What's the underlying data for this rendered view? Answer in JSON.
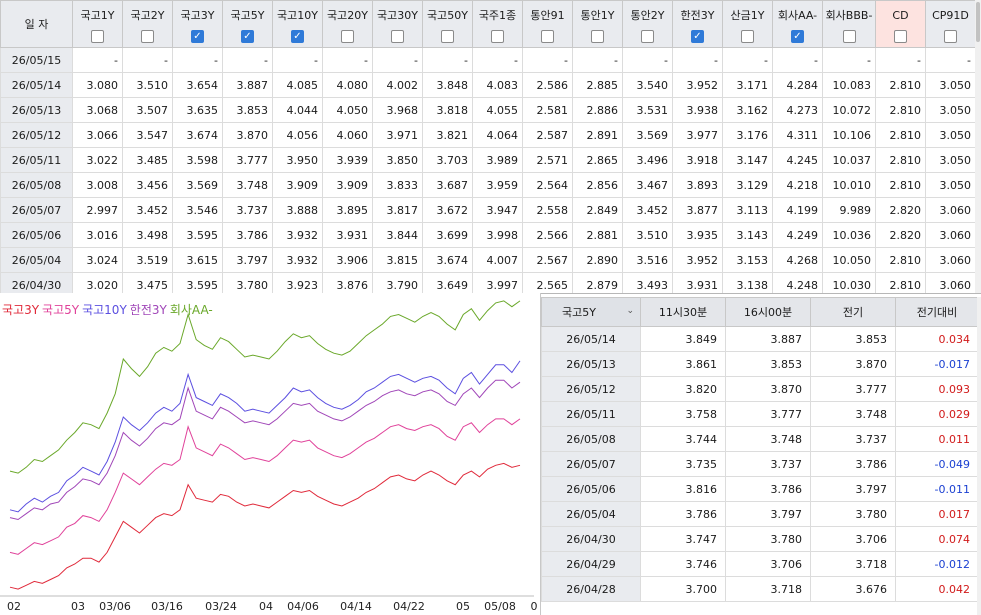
{
  "top_table": {
    "date_header": "일  자",
    "columns": [
      {
        "label": "국고1Y",
        "checked": false
      },
      {
        "label": "국고2Y",
        "checked": false
      },
      {
        "label": "국고3Y",
        "checked": true
      },
      {
        "label": "국고5Y",
        "checked": true
      },
      {
        "label": "국고10Y",
        "checked": true
      },
      {
        "label": "국고20Y",
        "checked": false
      },
      {
        "label": "국고30Y",
        "checked": false
      },
      {
        "label": "국고50Y",
        "checked": false
      },
      {
        "label": "국주1종",
        "checked": false
      },
      {
        "label": "통안91",
        "checked": false
      },
      {
        "label": "통안1Y",
        "checked": false
      },
      {
        "label": "통안2Y",
        "checked": false
      },
      {
        "label": "한전3Y",
        "checked": true
      },
      {
        "label": "산금1Y",
        "checked": false
      },
      {
        "label": "회사AA-",
        "checked": true
      },
      {
        "label": "회사BBB-",
        "checked": false
      },
      {
        "label": "CD",
        "checked": false
      },
      {
        "label": "CP91D",
        "checked": false
      }
    ],
    "rows": [
      {
        "date": "26/05/15",
        "values": [
          "-",
          "-",
          "-",
          "-",
          "-",
          "-",
          "-",
          "-",
          "-",
          "-",
          "-",
          "-",
          "-",
          "-",
          "-",
          "-",
          "-",
          "-"
        ]
      },
      {
        "date": "26/05/14",
        "values": [
          "3.080",
          "3.510",
          "3.654",
          "3.887",
          "4.085",
          "4.080",
          "4.002",
          "3.848",
          "4.083",
          "2.586",
          "2.885",
          "3.540",
          "3.952",
          "3.171",
          "4.284",
          "10.083",
          "2.810",
          "3.050"
        ]
      },
      {
        "date": "26/05/13",
        "values": [
          "3.068",
          "3.507",
          "3.635",
          "3.853",
          "4.044",
          "4.050",
          "3.968",
          "3.818",
          "4.055",
          "2.581",
          "2.886",
          "3.531",
          "3.938",
          "3.162",
          "4.273",
          "10.072",
          "2.810",
          "3.050"
        ]
      },
      {
        "date": "26/05/12",
        "values": [
          "3.066",
          "3.547",
          "3.674",
          "3.870",
          "4.056",
          "4.060",
          "3.971",
          "3.821",
          "4.064",
          "2.587",
          "2.891",
          "3.569",
          "3.977",
          "3.176",
          "4.311",
          "10.106",
          "2.810",
          "3.050"
        ]
      },
      {
        "date": "26/05/11",
        "values": [
          "3.022",
          "3.485",
          "3.598",
          "3.777",
          "3.950",
          "3.939",
          "3.850",
          "3.703",
          "3.989",
          "2.571",
          "2.865",
          "3.496",
          "3.918",
          "3.147",
          "4.245",
          "10.037",
          "2.810",
          "3.050"
        ]
      },
      {
        "date": "26/05/08",
        "values": [
          "3.008",
          "3.456",
          "3.569",
          "3.748",
          "3.909",
          "3.909",
          "3.833",
          "3.687",
          "3.959",
          "2.564",
          "2.856",
          "3.467",
          "3.893",
          "3.129",
          "4.218",
          "10.010",
          "2.810",
          "3.050"
        ]
      },
      {
        "date": "26/05/07",
        "values": [
          "2.997",
          "3.452",
          "3.546",
          "3.737",
          "3.888",
          "3.895",
          "3.817",
          "3.672",
          "3.947",
          "2.558",
          "2.849",
          "3.452",
          "3.877",
          "3.113",
          "4.199",
          "9.989",
          "2.820",
          "3.060"
        ]
      },
      {
        "date": "26/05/06",
        "values": [
          "3.016",
          "3.498",
          "3.595",
          "3.786",
          "3.932",
          "3.931",
          "3.844",
          "3.699",
          "3.998",
          "2.566",
          "2.881",
          "3.510",
          "3.935",
          "3.143",
          "4.249",
          "10.036",
          "2.820",
          "3.060"
        ]
      },
      {
        "date": "26/05/04",
        "values": [
          "3.024",
          "3.519",
          "3.615",
          "3.797",
          "3.932",
          "3.906",
          "3.815",
          "3.674",
          "4.007",
          "2.567",
          "2.890",
          "3.516",
          "3.952",
          "3.153",
          "4.268",
          "10.050",
          "2.810",
          "3.060"
        ]
      },
      {
        "date": "26/04/30",
        "values": [
          "3.020",
          "3.475",
          "3.595",
          "3.780",
          "3.923",
          "3.876",
          "3.790",
          "3.649",
          "3.997",
          "2.565",
          "2.879",
          "3.493",
          "3.931",
          "3.138",
          "4.248",
          "10.030",
          "2.810",
          "3.060"
        ]
      }
    ]
  },
  "chart_data": {
    "type": "line",
    "legend": [
      "국고3Y",
      "국고5Y",
      "국고10Y",
      "한전3Y",
      "회사AA-"
    ],
    "colors": [
      "#e0293a",
      "#e0429a",
      "#5b4fe0",
      "#a046b8",
      "#6aa82a"
    ],
    "x_tick_labels": [
      "02",
      "03",
      "03/06",
      "03/16",
      "03/24",
      "04",
      "04/06",
      "04/14",
      "04/22",
      "05",
      "05/08",
      "0"
    ],
    "series": [
      {
        "name": "국고3Y",
        "color": "#e0293a",
        "values": [
          3.02,
          3.01,
          3.03,
          3.05,
          3.04,
          3.06,
          3.08,
          3.12,
          3.14,
          3.17,
          3.17,
          3.15,
          3.2,
          3.28,
          3.36,
          3.33,
          3.3,
          3.34,
          3.38,
          3.4,
          3.39,
          3.42,
          3.55,
          3.48,
          3.47,
          3.46,
          3.5,
          3.49,
          3.46,
          3.44,
          3.45,
          3.44,
          3.43,
          3.46,
          3.49,
          3.52,
          3.51,
          3.52,
          3.49,
          3.47,
          3.45,
          3.44,
          3.46,
          3.48,
          3.51,
          3.53,
          3.56,
          3.59,
          3.6,
          3.58,
          3.57,
          3.6,
          3.62,
          3.6,
          3.57,
          3.55,
          3.6,
          3.62,
          3.59,
          3.63,
          3.65,
          3.66,
          3.64,
          3.65
        ]
      },
      {
        "name": "국고5Y",
        "color": "#e0429a",
        "values": [
          3.2,
          3.19,
          3.22,
          3.25,
          3.24,
          3.26,
          3.28,
          3.33,
          3.35,
          3.39,
          3.38,
          3.36,
          3.42,
          3.51,
          3.61,
          3.58,
          3.55,
          3.59,
          3.63,
          3.66,
          3.65,
          3.68,
          3.85,
          3.74,
          3.72,
          3.7,
          3.76,
          3.74,
          3.71,
          3.68,
          3.69,
          3.68,
          3.67,
          3.7,
          3.74,
          3.78,
          3.77,
          3.78,
          3.74,
          3.72,
          3.7,
          3.69,
          3.71,
          3.74,
          3.77,
          3.79,
          3.82,
          3.85,
          3.86,
          3.84,
          3.83,
          3.85,
          3.86,
          3.84,
          3.8,
          3.78,
          3.85,
          3.87,
          3.82,
          3.86,
          3.89,
          3.89,
          3.86,
          3.89
        ]
      },
      {
        "name": "국고10Y",
        "color": "#5b4fe0",
        "values": [
          3.42,
          3.41,
          3.45,
          3.48,
          3.46,
          3.49,
          3.51,
          3.57,
          3.6,
          3.64,
          3.62,
          3.6,
          3.67,
          3.77,
          3.9,
          3.86,
          3.83,
          3.87,
          3.92,
          3.95,
          3.93,
          3.97,
          4.12,
          4.0,
          3.98,
          3.96,
          4.02,
          4.0,
          3.97,
          3.93,
          3.94,
          3.93,
          3.92,
          3.96,
          4.0,
          4.05,
          4.03,
          4.04,
          4.0,
          3.97,
          3.95,
          3.94,
          3.96,
          3.99,
          4.03,
          4.05,
          4.08,
          4.11,
          4.12,
          4.1,
          4.08,
          4.1,
          4.11,
          4.09,
          4.05,
          4.02,
          4.1,
          4.13,
          4.07,
          4.12,
          4.17,
          4.17,
          4.13,
          4.19
        ]
      },
      {
        "name": "한전3Y",
        "color": "#a046b8",
        "values": [
          3.38,
          3.37,
          3.4,
          3.43,
          3.42,
          3.45,
          3.46,
          3.51,
          3.54,
          3.58,
          3.57,
          3.55,
          3.61,
          3.7,
          3.82,
          3.78,
          3.75,
          3.79,
          3.84,
          3.87,
          3.86,
          3.89,
          4.05,
          3.93,
          3.91,
          3.89,
          3.95,
          3.93,
          3.9,
          3.87,
          3.88,
          3.87,
          3.86,
          3.89,
          3.93,
          3.97,
          3.96,
          3.97,
          3.93,
          3.91,
          3.89,
          3.88,
          3.9,
          3.93,
          3.96,
          3.98,
          4.01,
          4.03,
          4.04,
          4.02,
          4.01,
          4.03,
          4.04,
          4.02,
          3.98,
          3.96,
          4.02,
          4.05,
          4.0,
          4.05,
          4.09,
          4.09,
          4.05,
          4.08
        ]
      },
      {
        "name": "회사AA-",
        "color": "#6aa82a",
        "values": [
          3.62,
          3.61,
          3.64,
          3.68,
          3.67,
          3.7,
          3.73,
          3.78,
          3.82,
          3.87,
          3.86,
          3.84,
          3.92,
          4.02,
          4.2,
          4.15,
          4.11,
          4.16,
          4.23,
          4.26,
          4.24,
          4.28,
          4.43,
          4.3,
          4.27,
          4.25,
          4.31,
          4.29,
          4.25,
          4.21,
          4.22,
          4.21,
          4.2,
          4.24,
          4.29,
          4.33,
          4.31,
          4.32,
          4.28,
          4.25,
          4.23,
          4.22,
          4.24,
          4.28,
          4.32,
          4.35,
          4.38,
          4.42,
          4.43,
          4.41,
          4.39,
          4.42,
          4.44,
          4.42,
          4.38,
          4.35,
          4.43,
          4.46,
          4.4,
          4.45,
          4.49,
          4.5,
          4.47,
          4.5
        ]
      }
    ]
  },
  "right_table": {
    "selector_label": "국고5Y",
    "headers": [
      "11시30분",
      "16시00분",
      "전기",
      "전기대비"
    ],
    "rows": [
      {
        "date": "26/05/14",
        "v1": "3.849",
        "v2": "3.887",
        "prev": "3.853",
        "diff": "0.034",
        "sign": "pos"
      },
      {
        "date": "26/05/13",
        "v1": "3.861",
        "v2": "3.853",
        "prev": "3.870",
        "diff": "-0.017",
        "sign": "neg"
      },
      {
        "date": "26/05/12",
        "v1": "3.820",
        "v2": "3.870",
        "prev": "3.777",
        "diff": "0.093",
        "sign": "pos"
      },
      {
        "date": "26/05/11",
        "v1": "3.758",
        "v2": "3.777",
        "prev": "3.748",
        "diff": "0.029",
        "sign": "pos"
      },
      {
        "date": "26/05/08",
        "v1": "3.744",
        "v2": "3.748",
        "prev": "3.737",
        "diff": "0.011",
        "sign": "pos"
      },
      {
        "date": "26/05/07",
        "v1": "3.735",
        "v2": "3.737",
        "prev": "3.786",
        "diff": "-0.049",
        "sign": "neg"
      },
      {
        "date": "26/05/06",
        "v1": "3.816",
        "v2": "3.786",
        "prev": "3.797",
        "diff": "-0.011",
        "sign": "neg"
      },
      {
        "date": "26/05/04",
        "v1": "3.786",
        "v2": "3.797",
        "prev": "3.780",
        "diff": "0.017",
        "sign": "pos"
      },
      {
        "date": "26/04/30",
        "v1": "3.747",
        "v2": "3.780",
        "prev": "3.706",
        "diff": "0.074",
        "sign": "pos"
      },
      {
        "date": "26/04/29",
        "v1": "3.746",
        "v2": "3.706",
        "prev": "3.718",
        "diff": "-0.012",
        "sign": "neg"
      },
      {
        "date": "26/04/28",
        "v1": "3.700",
        "v2": "3.718",
        "prev": "3.676",
        "diff": "0.042",
        "sign": "pos"
      }
    ]
  }
}
